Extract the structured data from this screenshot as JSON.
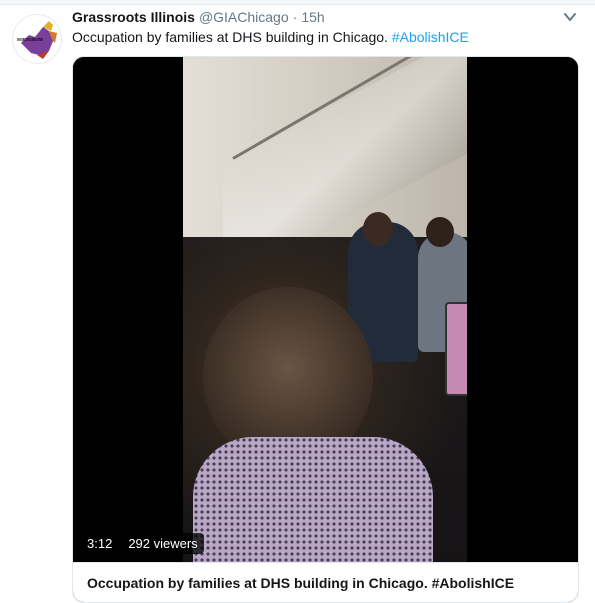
{
  "tweet": {
    "author": {
      "display_name": "Grassroots Illinois",
      "handle": "@GIAChicago",
      "separator": "·",
      "time": "15h",
      "avatar_text": "GRASSROOTS ILLINOIS ACTION",
      "avatar_icon": "illinois-state-map-icon"
    },
    "text": "Occupation by families at DHS building in Chicago.",
    "hashtag": "#AbolishICE",
    "menu_icon": "chevron-down-icon"
  },
  "video": {
    "duration": "3:12",
    "viewers": "292 viewers",
    "title": "Occupation by families at DHS building in Chicago. #AbolishICE"
  },
  "colors": {
    "link": "#1da1f2",
    "text": "#14171a",
    "secondary": "#657786",
    "border": "#e1e8ed"
  }
}
